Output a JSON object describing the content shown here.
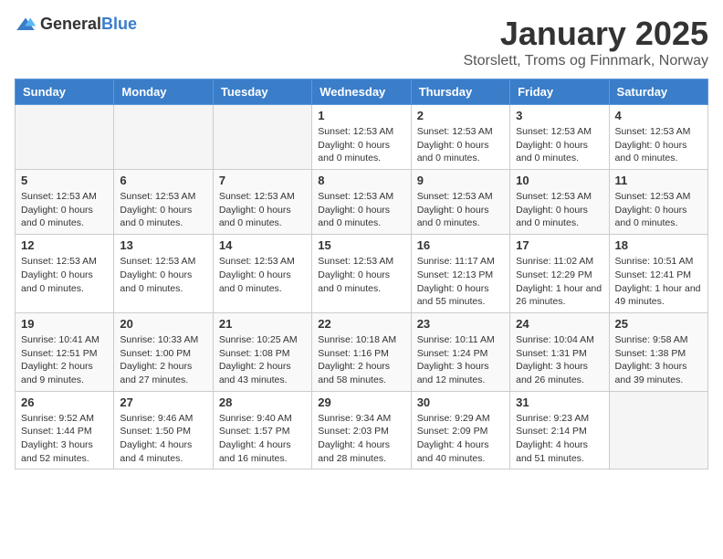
{
  "header": {
    "logo_general": "General",
    "logo_blue": "Blue",
    "title": "January 2025",
    "subtitle": "Storslett, Troms og Finnmark, Norway"
  },
  "weekdays": [
    "Sunday",
    "Monday",
    "Tuesday",
    "Wednesday",
    "Thursday",
    "Friday",
    "Saturday"
  ],
  "weeks": [
    [
      {
        "day": "",
        "info": ""
      },
      {
        "day": "",
        "info": ""
      },
      {
        "day": "",
        "info": ""
      },
      {
        "day": "1",
        "info": "Sunset: 12:53 AM\nDaylight: 0 hours and 0 minutes."
      },
      {
        "day": "2",
        "info": "Sunset: 12:53 AM\nDaylight: 0 hours and 0 minutes."
      },
      {
        "day": "3",
        "info": "Sunset: 12:53 AM\nDaylight: 0 hours and 0 minutes."
      },
      {
        "day": "4",
        "info": "Sunset: 12:53 AM\nDaylight: 0 hours and 0 minutes."
      }
    ],
    [
      {
        "day": "5",
        "info": "Sunset: 12:53 AM\nDaylight: 0 hours and 0 minutes."
      },
      {
        "day": "6",
        "info": "Sunset: 12:53 AM\nDaylight: 0 hours and 0 minutes."
      },
      {
        "day": "7",
        "info": "Sunset: 12:53 AM\nDaylight: 0 hours and 0 minutes."
      },
      {
        "day": "8",
        "info": "Sunset: 12:53 AM\nDaylight: 0 hours and 0 minutes."
      },
      {
        "day": "9",
        "info": "Sunset: 12:53 AM\nDaylight: 0 hours and 0 minutes."
      },
      {
        "day": "10",
        "info": "Sunset: 12:53 AM\nDaylight: 0 hours and 0 minutes."
      },
      {
        "day": "11",
        "info": "Sunset: 12:53 AM\nDaylight: 0 hours and 0 minutes."
      }
    ],
    [
      {
        "day": "12",
        "info": "Sunset: 12:53 AM\nDaylight: 0 hours and 0 minutes."
      },
      {
        "day": "13",
        "info": "Sunset: 12:53 AM\nDaylight: 0 hours and 0 minutes."
      },
      {
        "day": "14",
        "info": "Sunset: 12:53 AM\nDaylight: 0 hours and 0 minutes."
      },
      {
        "day": "15",
        "info": "Sunset: 12:53 AM\nDaylight: 0 hours and 0 minutes."
      },
      {
        "day": "16",
        "info": "Sunrise: 11:17 AM\nSunset: 12:13 PM\nDaylight: 0 hours and 55 minutes."
      },
      {
        "day": "17",
        "info": "Sunrise: 11:02 AM\nSunset: 12:29 PM\nDaylight: 1 hour and 26 minutes."
      },
      {
        "day": "18",
        "info": "Sunrise: 10:51 AM\nSunset: 12:41 PM\nDaylight: 1 hour and 49 minutes."
      }
    ],
    [
      {
        "day": "19",
        "info": "Sunrise: 10:41 AM\nSunset: 12:51 PM\nDaylight: 2 hours and 9 minutes."
      },
      {
        "day": "20",
        "info": "Sunrise: 10:33 AM\nSunset: 1:00 PM\nDaylight: 2 hours and 27 minutes."
      },
      {
        "day": "21",
        "info": "Sunrise: 10:25 AM\nSunset: 1:08 PM\nDaylight: 2 hours and 43 minutes."
      },
      {
        "day": "22",
        "info": "Sunrise: 10:18 AM\nSunset: 1:16 PM\nDaylight: 2 hours and 58 minutes."
      },
      {
        "day": "23",
        "info": "Sunrise: 10:11 AM\nSunset: 1:24 PM\nDaylight: 3 hours and 12 minutes."
      },
      {
        "day": "24",
        "info": "Sunrise: 10:04 AM\nSunset: 1:31 PM\nDaylight: 3 hours and 26 minutes."
      },
      {
        "day": "25",
        "info": "Sunrise: 9:58 AM\nSunset: 1:38 PM\nDaylight: 3 hours and 39 minutes."
      }
    ],
    [
      {
        "day": "26",
        "info": "Sunrise: 9:52 AM\nSunset: 1:44 PM\nDaylight: 3 hours and 52 minutes."
      },
      {
        "day": "27",
        "info": "Sunrise: 9:46 AM\nSunset: 1:50 PM\nDaylight: 4 hours and 4 minutes."
      },
      {
        "day": "28",
        "info": "Sunrise: 9:40 AM\nSunset: 1:57 PM\nDaylight: 4 hours and 16 minutes."
      },
      {
        "day": "29",
        "info": "Sunrise: 9:34 AM\nSunset: 2:03 PM\nDaylight: 4 hours and 28 minutes."
      },
      {
        "day": "30",
        "info": "Sunrise: 9:29 AM\nSunset: 2:09 PM\nDaylight: 4 hours and 40 minutes."
      },
      {
        "day": "31",
        "info": "Sunrise: 9:23 AM\nSunset: 2:14 PM\nDaylight: 4 hours and 51 minutes."
      },
      {
        "day": "",
        "info": ""
      }
    ]
  ]
}
